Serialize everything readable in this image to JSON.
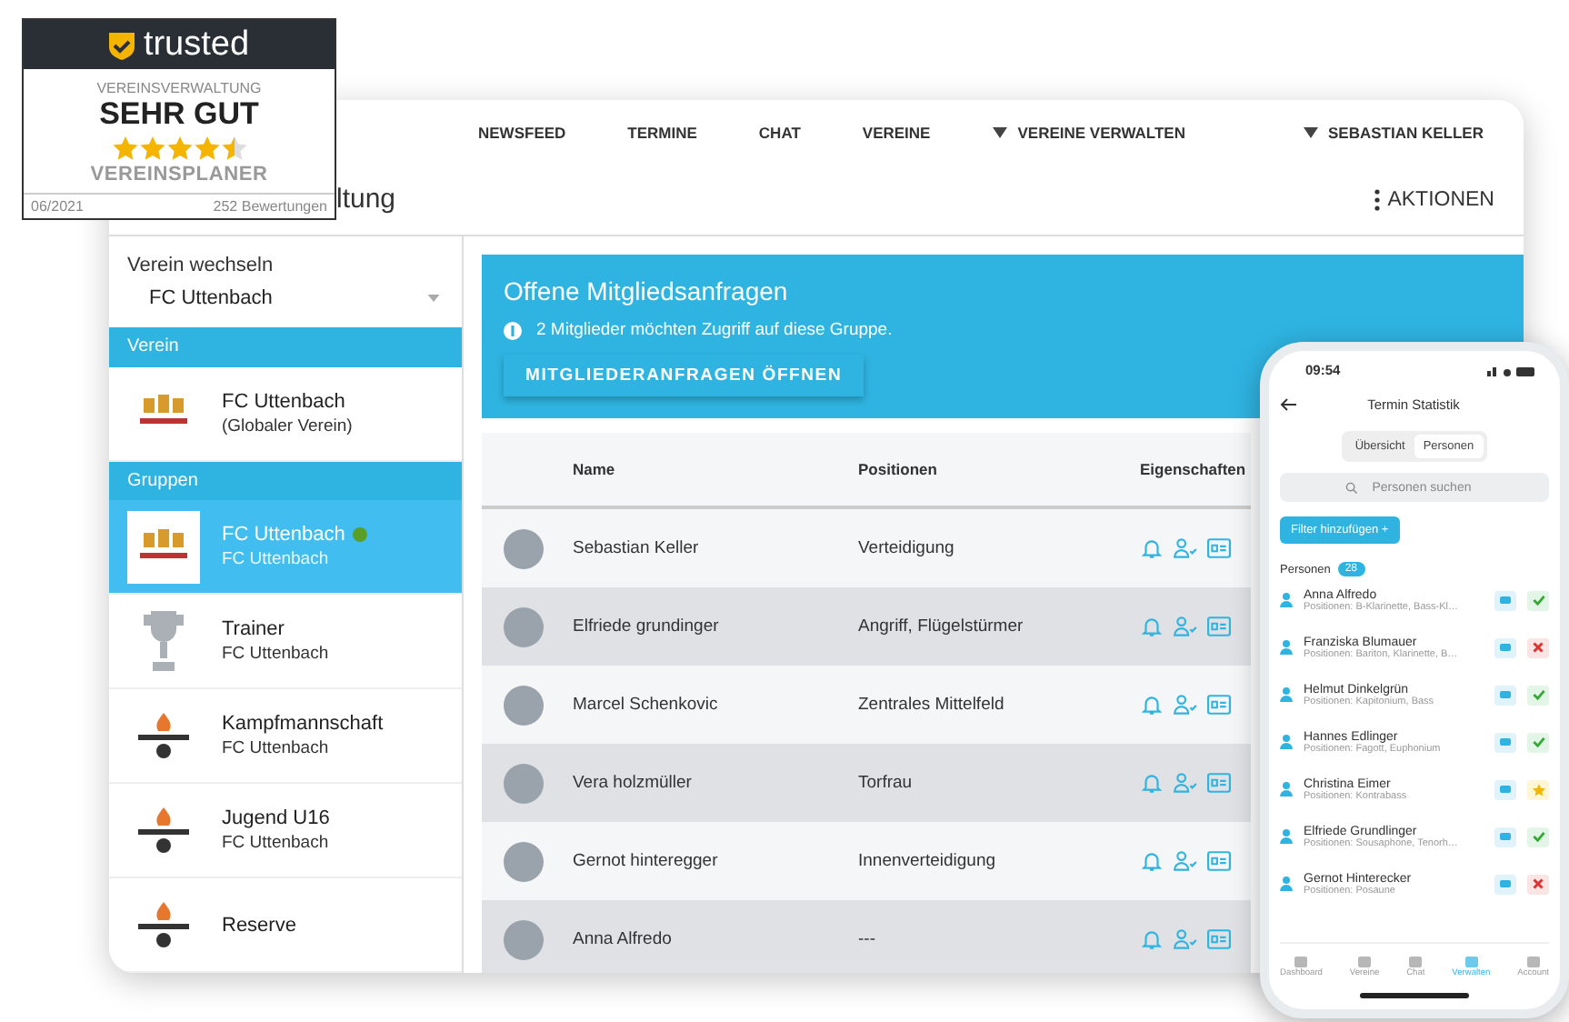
{
  "badge": {
    "brand": "trusted",
    "category": "VEREINSVERWALTUNG",
    "rating": "SEHR GUT",
    "stars": 4.5,
    "product": "VEREINSPLANER",
    "date": "06/2021",
    "reviews": "252 Bewertungen"
  },
  "nav": {
    "items": [
      {
        "label": "NEWSFEED",
        "dropdown": false
      },
      {
        "label": "TERMINE",
        "dropdown": false
      },
      {
        "label": "CHAT",
        "dropdown": false
      },
      {
        "label": "VEREINE",
        "dropdown": false
      },
      {
        "label": "VEREINE VERWALTEN",
        "dropdown": true
      }
    ],
    "user": "SEBASTIAN KELLER"
  },
  "page": {
    "title": "ltung",
    "actions": "AKTIONEN"
  },
  "sidebar": {
    "switch_label": "Verein wechseln",
    "club_select": "FC Uttenbach",
    "sections": [
      {
        "title": "Verein",
        "items": [
          {
            "name": "FC Uttenbach",
            "subtitle": "(Globaler Verein)",
            "selected": false,
            "online": false,
            "kind": "crest"
          }
        ]
      },
      {
        "title": "Gruppen",
        "items": [
          {
            "name": "FC Uttenbach",
            "subtitle": "FC Uttenbach",
            "selected": true,
            "online": true,
            "kind": "crest"
          },
          {
            "name": "Trainer",
            "subtitle": "FC Uttenbach",
            "selected": false,
            "online": false,
            "kind": "trophy"
          },
          {
            "name": "Kampfmannschaft",
            "subtitle": "FC Uttenbach",
            "selected": false,
            "online": false,
            "kind": "team"
          },
          {
            "name": "Jugend U16",
            "subtitle": "FC Uttenbach",
            "selected": false,
            "online": false,
            "kind": "team"
          },
          {
            "name": "Reserve",
            "selected": false,
            "online": false,
            "kind": "team"
          }
        ]
      }
    ]
  },
  "requests": {
    "title": "Offene Mitgliedsanfragen",
    "info": "2 Mitglieder möchten Zugriff auf diese Gruppe.",
    "button": "MITGLIEDERANFRAGEN ÖFFNEN"
  },
  "table": {
    "columns": [
      "Name",
      "Positionen",
      "Eigenschaften"
    ],
    "rows": [
      {
        "name": "Sebastian Keller",
        "positions": "Verteidigung"
      },
      {
        "name": "Elfriede grundinger",
        "positions": "Angriff, Flügelstürmer"
      },
      {
        "name": "Marcel Schenkovic",
        "positions": "Zentrales Mittelfeld"
      },
      {
        "name": "Vera holzmüller",
        "positions": "Torfrau"
      },
      {
        "name": "Gernot hinteregger",
        "positions": "Innenverteidigung"
      },
      {
        "name": "Anna Alfredo",
        "positions": "---"
      }
    ]
  },
  "phone": {
    "time": "09:54",
    "title": "Termin Statistik",
    "tabs": [
      {
        "label": "Übersicht",
        "selected": false
      },
      {
        "label": "Personen",
        "selected": true
      }
    ],
    "search": {
      "placeholder": "Personen suchen"
    },
    "filter_button": "Filter hinzufügen +",
    "list_label": "Personen",
    "count": "28",
    "people": [
      {
        "name": "Anna Alfredo",
        "positions": "Positionen: B-Klarinette, Bass-Kl…",
        "kind": "yes"
      },
      {
        "name": "Franziska Blumauer",
        "positions": "Positionen: Bariton, Klarinette, B…",
        "kind": "no"
      },
      {
        "name": "Helmut Dinkelgrün",
        "positions": "Positionen: Kapitonium, Bass",
        "kind": "yes"
      },
      {
        "name": "Hannes Edlinger",
        "positions": "Positionen: Fagott, Euphonium",
        "kind": "yes"
      },
      {
        "name": "Christina Eimer",
        "positions": "Positionen: Kontrabass",
        "kind": "maybe"
      },
      {
        "name": "Elfriede Grundlinger",
        "positions": "Positionen: Sousaphone, Tenorh…",
        "kind": "yes"
      },
      {
        "name": "Gernot Hinterecker",
        "positions": "Positionen: Posaune",
        "kind": "no"
      }
    ],
    "tabbar": [
      {
        "label": "Dashboard",
        "selected": false
      },
      {
        "label": "Vereine",
        "selected": false
      },
      {
        "label": "Chat",
        "selected": false
      },
      {
        "label": "Verwalten",
        "selected": true
      },
      {
        "label": "Account",
        "selected": false
      }
    ]
  }
}
